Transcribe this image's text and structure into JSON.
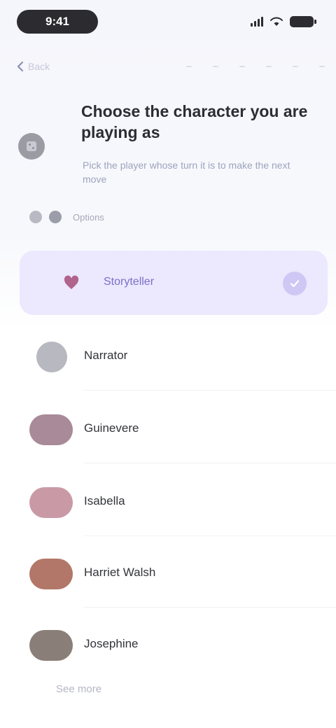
{
  "status_bar": {
    "time": "9:41"
  },
  "header": {
    "back_label": "Back"
  },
  "game": {
    "title": "Choose the character you are playing as",
    "subtitle": "Pick the player whose turn it is to make the next move"
  },
  "options": {
    "label": "Options"
  },
  "selected": {
    "label": "Storyteller"
  },
  "players": [
    {
      "name": "Narrator",
      "avatar_color": "#b7b8c0"
    },
    {
      "name": "Guinevere",
      "avatar_color": "#a88a98"
    },
    {
      "name": "Isabella",
      "avatar_color": "#c99aa6"
    },
    {
      "name": "Harriet Walsh",
      "avatar_color": "#b27768"
    },
    {
      "name": "Josephine",
      "avatar_color": "#8a7f78"
    }
  ],
  "footer": {
    "more_label": "See more"
  },
  "colors": {
    "accent": "#7a6fc8",
    "selected_bg": "#ece8fd"
  }
}
